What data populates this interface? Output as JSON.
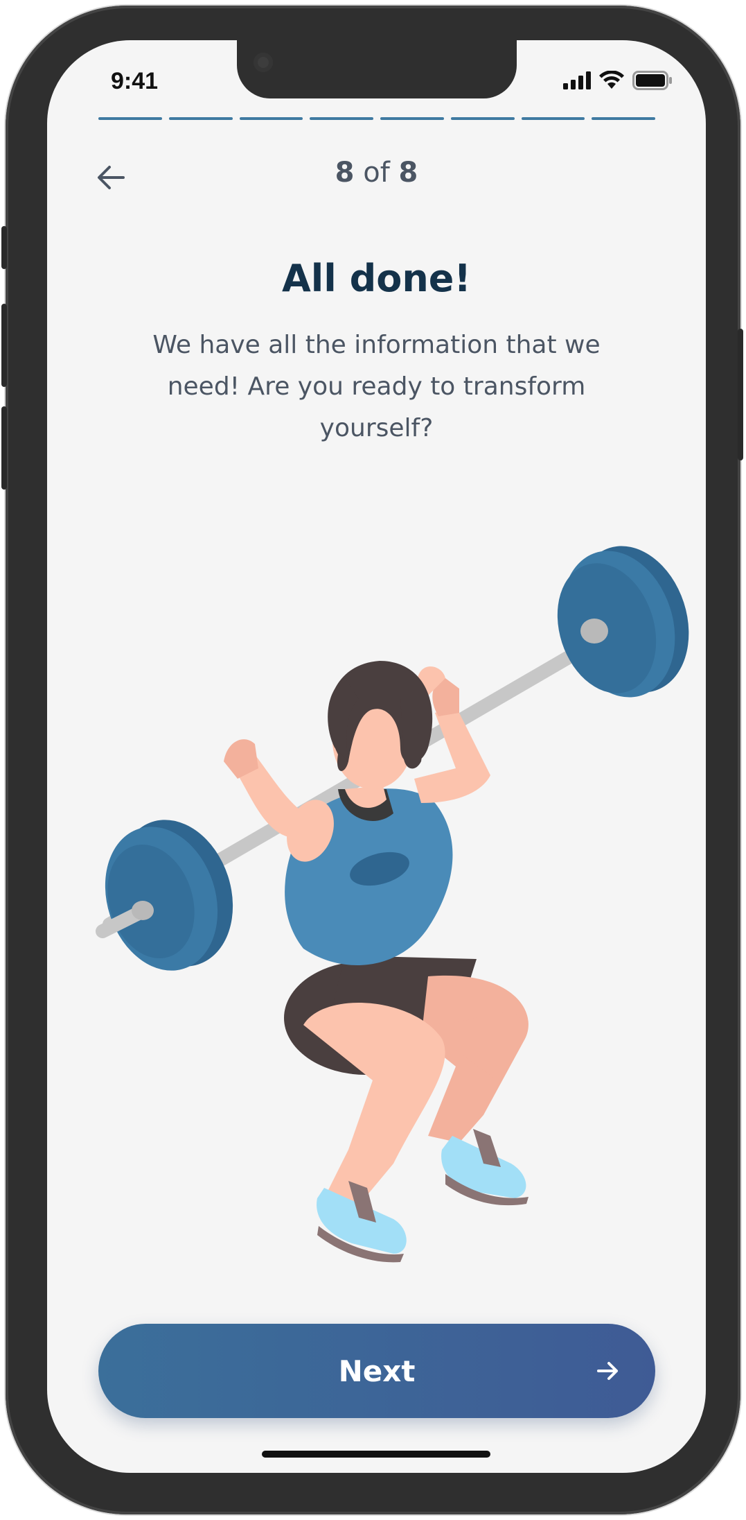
{
  "status_bar": {
    "time": "9:41",
    "signal_icon": "signal-icon",
    "wifi_icon": "wifi-icon",
    "battery_icon": "battery-icon"
  },
  "progress": {
    "total_steps": 8,
    "completed_steps": 8,
    "color": "#3f7aa1"
  },
  "header": {
    "back_icon": "arrow-left-icon",
    "step_current": "8",
    "step_separator": "of",
    "step_total": "8"
  },
  "content": {
    "title": "All done!",
    "subtitle": "We have all the information that we need! Are you ready to transform yourself?",
    "illustration": "woman-lifting-barbell-illustration"
  },
  "footer": {
    "next_label": "Next",
    "next_icon": "arrow-right-icon",
    "button_gradient": [
      "#3b6f9a",
      "#3f5b95"
    ]
  }
}
